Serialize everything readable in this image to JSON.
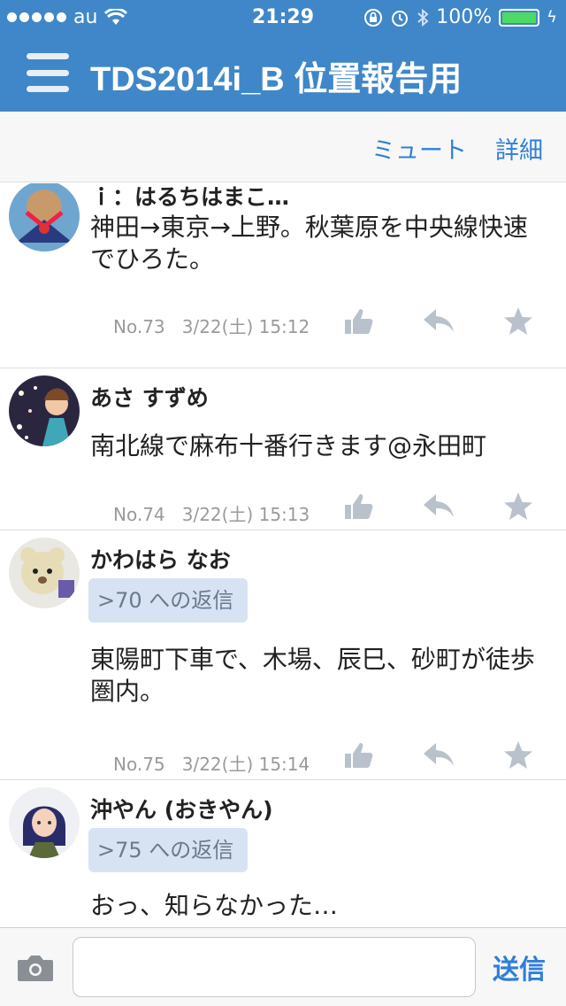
{
  "status_bar": {
    "carrier": "au",
    "time": "21:29",
    "battery": "100%"
  },
  "nav": {
    "title": "TDS2014i_B 位置報告用"
  },
  "toolbar": {
    "mute_label": "ミュート",
    "detail_label": "詳細"
  },
  "messages": [
    {
      "name": "ｉ：はるちはまこ…",
      "reply": "",
      "body": "神田→東京→上野。秋葉原を中央線快速でひろた。",
      "number": "No.73",
      "datetime": "3/22(土) 15:12"
    },
    {
      "name": "あさ すずめ",
      "reply": "",
      "body": "南北線で麻布十番行きます@永田町",
      "number": "No.74",
      "datetime": "3/22(土) 15:13"
    },
    {
      "name": "かわはら なお",
      "reply": ">70 への返信",
      "body": "東陽町下車で、木場、辰巳、砂町が徒歩圏内。",
      "number": "No.75",
      "datetime": "3/22(土) 15:14"
    },
    {
      "name": "沖やん (おきやん)",
      "reply": ">75 への返信",
      "body": "おっ、知らなかった…",
      "number": "",
      "datetime": ""
    }
  ],
  "composer": {
    "input_value": "",
    "send_label": "送信"
  },
  "icons": {
    "menu": "hamburger-icon",
    "like": "thumbs-up-icon",
    "reply": "reply-arrow-icon",
    "favorite": "star-icon",
    "camera": "camera-icon"
  },
  "colors": {
    "nav_bg": "#3f87c8",
    "accent": "#2f7fd9",
    "reply_chip_bg": "#d7e3f3",
    "battery": "#4cd964"
  }
}
